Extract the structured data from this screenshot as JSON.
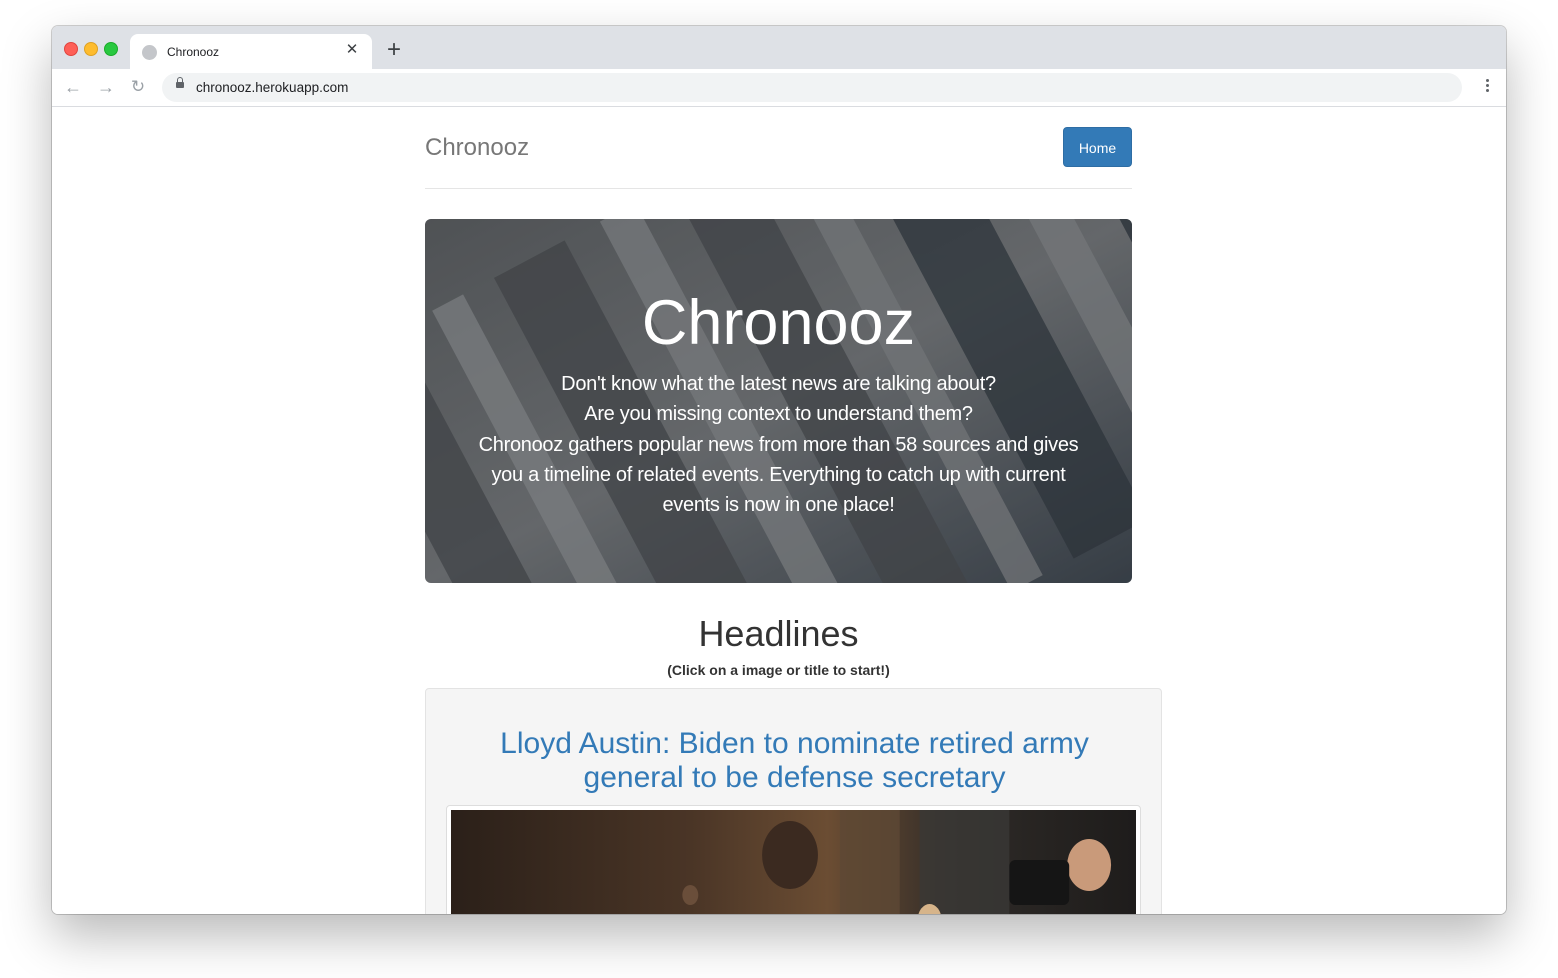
{
  "browser": {
    "tab_title": "Chronooz",
    "tab_close": "✕",
    "new_tab": "+",
    "url": "chronooz.herokuapp.com",
    "back": "←",
    "forward": "→",
    "reload": "↻"
  },
  "header": {
    "brand": "Chronooz",
    "home_label": "Home"
  },
  "jumbotron": {
    "title": "Chronooz",
    "lines": [
      "Don't know what the latest news are talking about?",
      "Are you missing context to understand them?",
      "Chronooz gathers popular news from more than 58 sources and gives you a timeline of related events. Everything to catch up with current events is now in one place!"
    ]
  },
  "headlines": {
    "title": "Headlines",
    "subtitle": "(Click on a image or title to start!)",
    "items": [
      {
        "title": "Lloyd Austin: Biden to nominate retired army general to be defense secretary"
      }
    ]
  },
  "colors": {
    "primary": "#337ab7",
    "brand_text": "#777777",
    "tab_strip": "#dee1e6"
  }
}
